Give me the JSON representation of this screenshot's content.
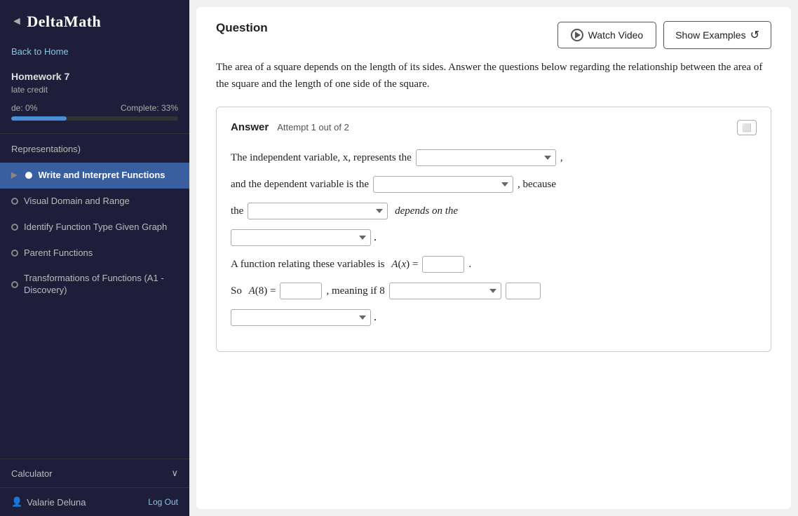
{
  "sidebar": {
    "logo": "DeltaMath",
    "logo_arrow": "◄",
    "back_to_home": "Back to Home",
    "homework_title": "Homework 7",
    "homework_subtitle": "late credit",
    "progress": {
      "grade_label": "de: 0%",
      "complete_label": "Complete: 33%",
      "fill_percent": 33
    },
    "nav_items": [
      {
        "id": "representations",
        "label": "Representations)",
        "active": false,
        "has_dot": false,
        "has_arrow": false
      },
      {
        "id": "write-interpret",
        "label": "Write and Interpret Functions",
        "active": true,
        "has_dot": true,
        "has_arrow": true
      },
      {
        "id": "visual-domain",
        "label": "Visual Domain and Range",
        "active": false,
        "has_dot": true,
        "has_arrow": false
      },
      {
        "id": "identify-function",
        "label": "Identify Function Type Given Graph",
        "active": false,
        "has_dot": true,
        "has_arrow": false
      },
      {
        "id": "parent-functions",
        "label": "Parent Functions",
        "active": false,
        "has_dot": true,
        "has_arrow": false
      },
      {
        "id": "transformations",
        "label": "Transformations of Functions (A1 - Discovery)",
        "active": false,
        "has_dot": true,
        "has_arrow": false
      }
    ],
    "calculator_label": "Calculator",
    "user_name": "Valarie Deluna",
    "logout_label": "Log Out"
  },
  "main": {
    "question_label": "Question",
    "watch_video_label": "Watch Video",
    "show_examples_label": "Show Examples",
    "question_text": "The area of a square depends on the length of its sides. Answer the questions below regarding the relationship between the area of the square and the length of one side of the square.",
    "answer": {
      "label": "Answer",
      "attempt_label": "Attempt 1 out of 2",
      "line1_prefix": "The independent variable, x, represents the",
      "line1_suffix": ",",
      "line2_prefix": "and the dependent variable is the",
      "line2_suffix": ", because",
      "line3_prefix": "the",
      "line3_suffix": "depends on the",
      "line4_placeholder": "",
      "function_line_prefix": "A function relating these variables is",
      "function_name": "A(x) =",
      "function_input": "",
      "so_line_prefix": "So",
      "so_function": "A(8) =",
      "so_input": "",
      "so_meaning": ", meaning if 8"
    }
  }
}
